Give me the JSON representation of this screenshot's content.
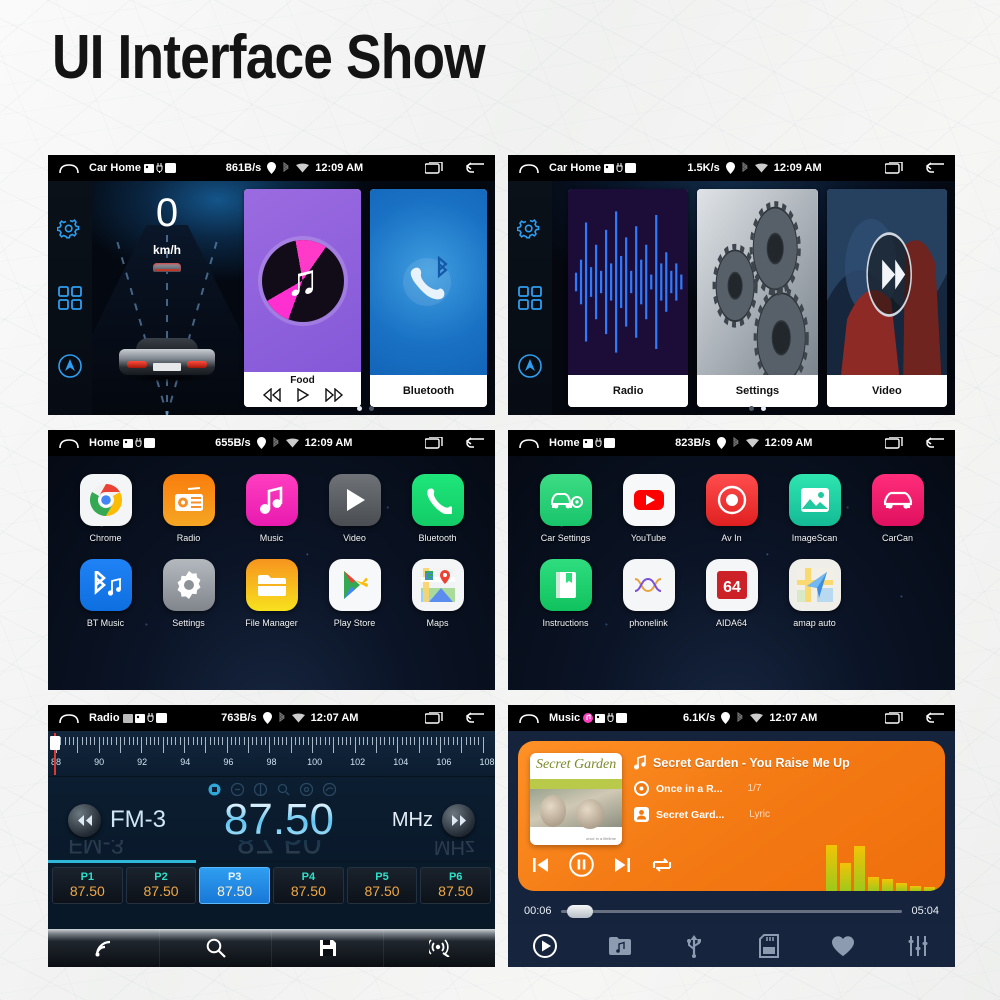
{
  "page": {
    "title": "UI Interface Show"
  },
  "panels": {
    "car_home_1": {
      "status": {
        "title": "Car Home",
        "speed": "861B/s",
        "time": "12:09 AM",
        "icons": [
          "home-icon",
          "sd-card-icon",
          "usb-icon",
          "battery-icon",
          "location-icon",
          "bluetooth-icon",
          "wifi-icon",
          "recents-icon",
          "back-icon"
        ]
      },
      "speedometer": {
        "value": "0",
        "unit": "km/h"
      },
      "rail": [
        "gear-icon",
        "apps-grid-icon",
        "navigation-icon"
      ],
      "cards": [
        {
          "label": "Food",
          "type": "music",
          "controls": [
            "prev",
            "play",
            "next"
          ]
        },
        {
          "label": "Bluetooth",
          "type": "bluetooth"
        }
      ],
      "dots": {
        "count": 2,
        "active": 0
      }
    },
    "car_home_2": {
      "status": {
        "title": "Car Home",
        "speed": "1.5K/s",
        "time": "12:09 AM"
      },
      "rail": [
        "gear-icon",
        "apps-grid-icon",
        "navigation-icon"
      ],
      "cards": [
        {
          "label": "Radio",
          "type": "waveform"
        },
        {
          "label": "Settings",
          "type": "gears"
        },
        {
          "label": "Video",
          "type": "video"
        }
      ],
      "dots": {
        "count": 2,
        "active": 1
      }
    },
    "apps_1": {
      "status": {
        "title": "Home",
        "speed": "655B/s",
        "time": "12:09 AM"
      },
      "rows": [
        [
          {
            "label": "Chrome",
            "icon": "chrome-icon"
          },
          {
            "label": "Radio",
            "icon": "radio-icon"
          },
          {
            "label": "Music",
            "icon": "music-note-icon"
          },
          {
            "label": "Video",
            "icon": "play-icon"
          },
          {
            "label": "Bluetooth",
            "icon": "phone-icon"
          }
        ],
        [
          {
            "label": "BT Music",
            "icon": "bluetooth-music-icon"
          },
          {
            "label": "Settings",
            "icon": "gear-icon"
          },
          {
            "label": "File Manager",
            "icon": "folder-icon"
          },
          {
            "label": "Play Store",
            "icon": "play-store-icon"
          },
          {
            "label": "Maps",
            "icon": "maps-icon"
          }
        ]
      ]
    },
    "apps_2": {
      "status": {
        "title": "Home",
        "speed": "823B/s",
        "time": "12:09 AM"
      },
      "rows": [
        [
          {
            "label": "Car Settings",
            "icon": "car-gear-icon"
          },
          {
            "label": "YouTube",
            "icon": "youtube-icon"
          },
          {
            "label": "Av In",
            "icon": "av-in-icon"
          },
          {
            "label": "ImageScan",
            "icon": "image-icon"
          },
          {
            "label": "CarCan",
            "icon": "car-icon"
          }
        ],
        [
          {
            "label": "Instructions",
            "icon": "book-icon"
          },
          {
            "label": "phonelink",
            "icon": "phonelink-icon"
          },
          {
            "label": "AIDA64",
            "icon": "aida64-icon"
          },
          {
            "label": "amap auto",
            "icon": "amap-icon"
          }
        ]
      ]
    },
    "radio": {
      "status": {
        "title": "Radio",
        "speed": "763B/s",
        "time": "12:07 AM"
      },
      "scale": {
        "min": 88,
        "max": 108,
        "labels": [
          "88",
          "90",
          "92",
          "94",
          "96",
          "98",
          "100",
          "102",
          "104",
          "106",
          "108"
        ],
        "cursor": 87.9
      },
      "band": "FM-3",
      "frequency": "87.50",
      "unit": "MHz",
      "presets": [
        {
          "name": "P1",
          "freq": "87.50",
          "active": false
        },
        {
          "name": "P2",
          "freq": "87.50",
          "active": false
        },
        {
          "name": "P3",
          "freq": "87.50",
          "active": true
        },
        {
          "name": "P4",
          "freq": "87.50",
          "active": false
        },
        {
          "name": "P5",
          "freq": "87.50",
          "active": false
        },
        {
          "name": "P6",
          "freq": "87.50",
          "active": false
        }
      ],
      "bottom_icons": [
        "signal-icon",
        "search-icon",
        "save-icon",
        "antenna-icon"
      ]
    },
    "music": {
      "status": {
        "title": "Music",
        "speed": "6.1K/s",
        "time": "12:07 AM"
      },
      "track": "Secret Garden - You Raise Me Up",
      "album": "Once in a R...",
      "artist": "Secret Gard...",
      "track_index": "1/7",
      "lyric_label": "Lyric",
      "cover_title": "Secret Garden",
      "elapsed": "00:06",
      "duration": "05:04",
      "controls": [
        "prev-icon",
        "pause-icon",
        "next-icon",
        "repeat-icon"
      ],
      "bottom_icons": [
        "play-icon",
        "folder-music-icon",
        "usb-icon",
        "sd-card-icon",
        "favorite-icon",
        "equalizer-icon"
      ],
      "eq_levels": [
        46,
        28,
        45,
        14,
        12,
        8,
        5,
        4
      ]
    }
  },
  "colors": {
    "accent_blue": "#2f9ef0",
    "music_orange": "#f47b15",
    "preset_green": "#2fe0c8",
    "preset_amber": "#f0a846"
  }
}
